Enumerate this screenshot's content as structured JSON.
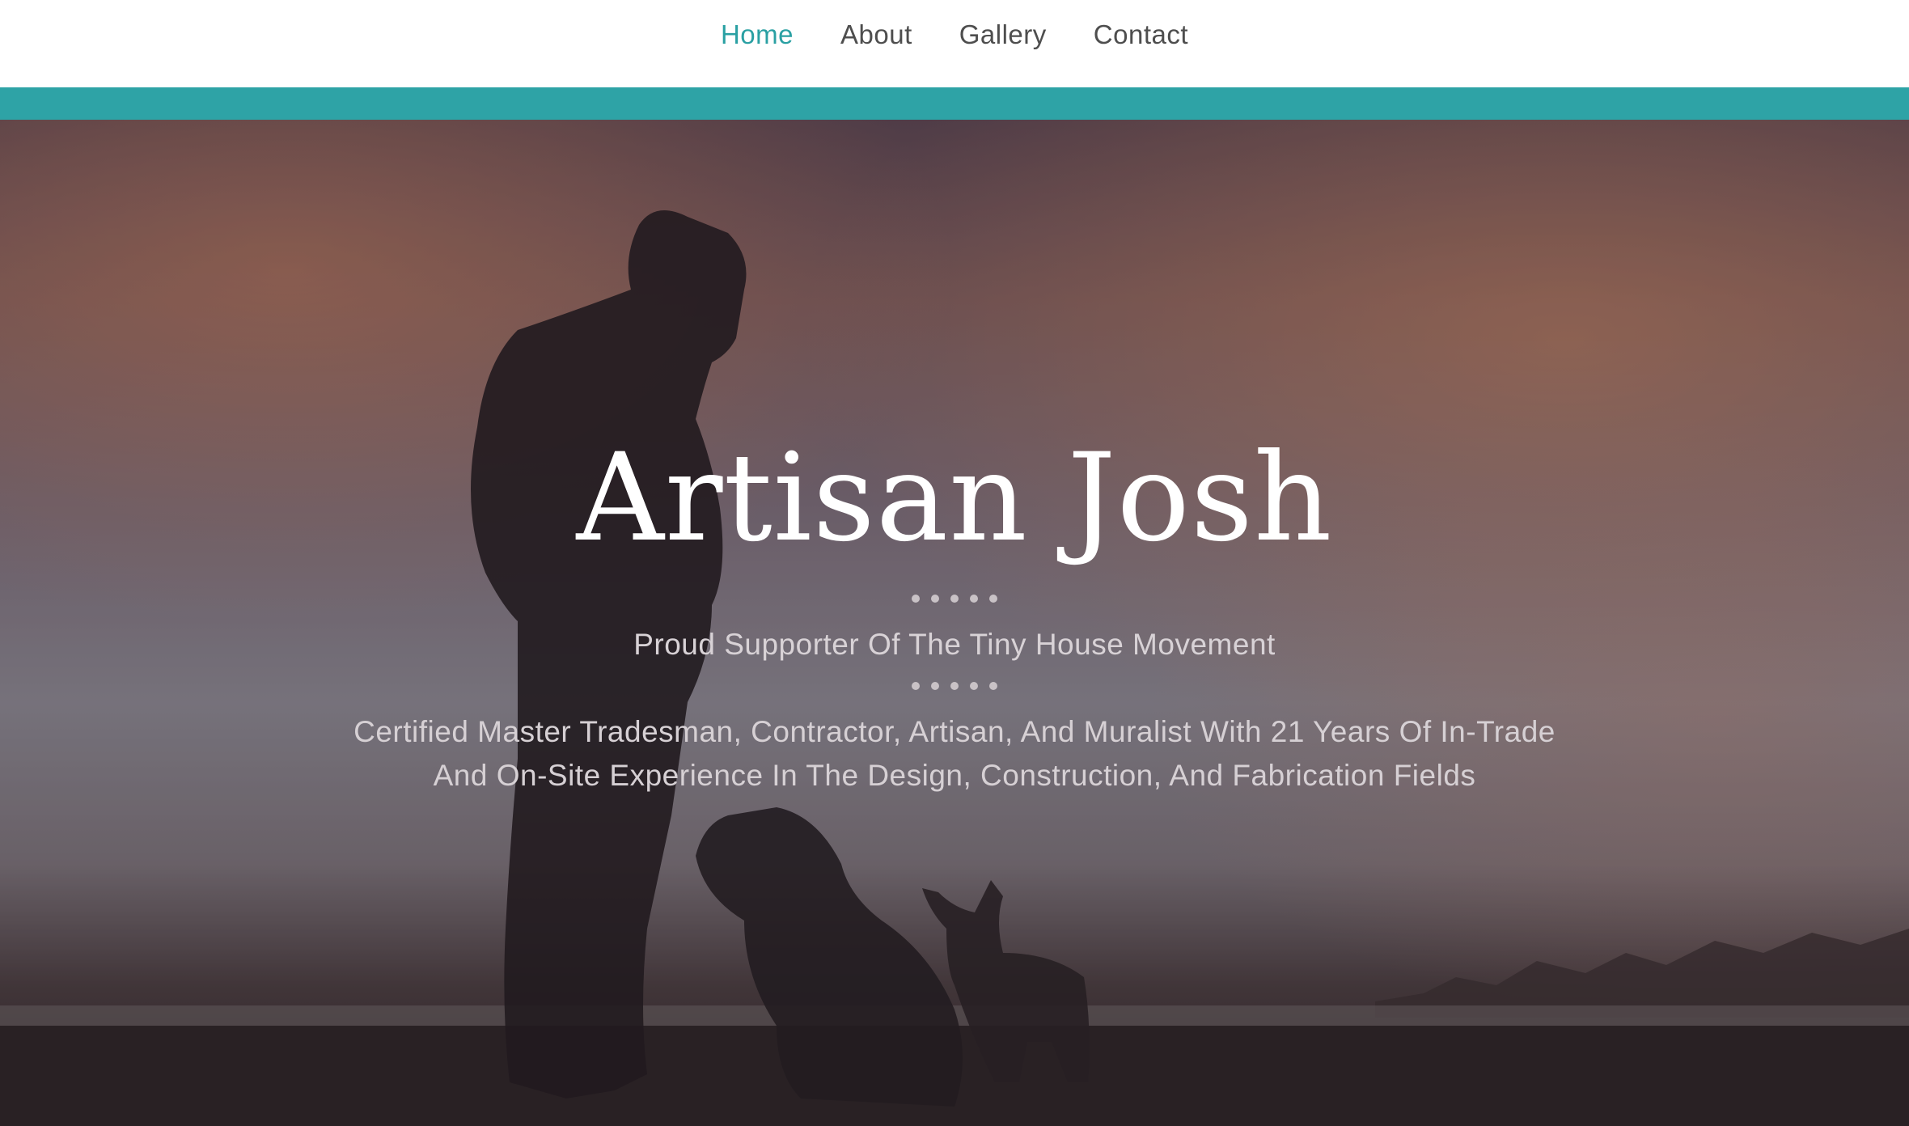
{
  "nav": {
    "items": [
      {
        "label": "Home",
        "active": true
      },
      {
        "label": "About",
        "active": false
      },
      {
        "label": "Gallery",
        "active": false
      },
      {
        "label": "Contact",
        "active": false
      }
    ]
  },
  "colors": {
    "accent": "#2ea3a6",
    "nav_active": "#2aa0a3",
    "nav_text": "#4e4e4e"
  },
  "hero": {
    "title": "Artisan Josh",
    "subtitle": "Proud Supporter Of The Tiny House Movement",
    "description": "Certified Master Tradesman, Contractor, Artisan, And Muralist With 21 Years Of In-Trade And On-Site Experience In The Design, Construction, And Fabrication Fields"
  }
}
